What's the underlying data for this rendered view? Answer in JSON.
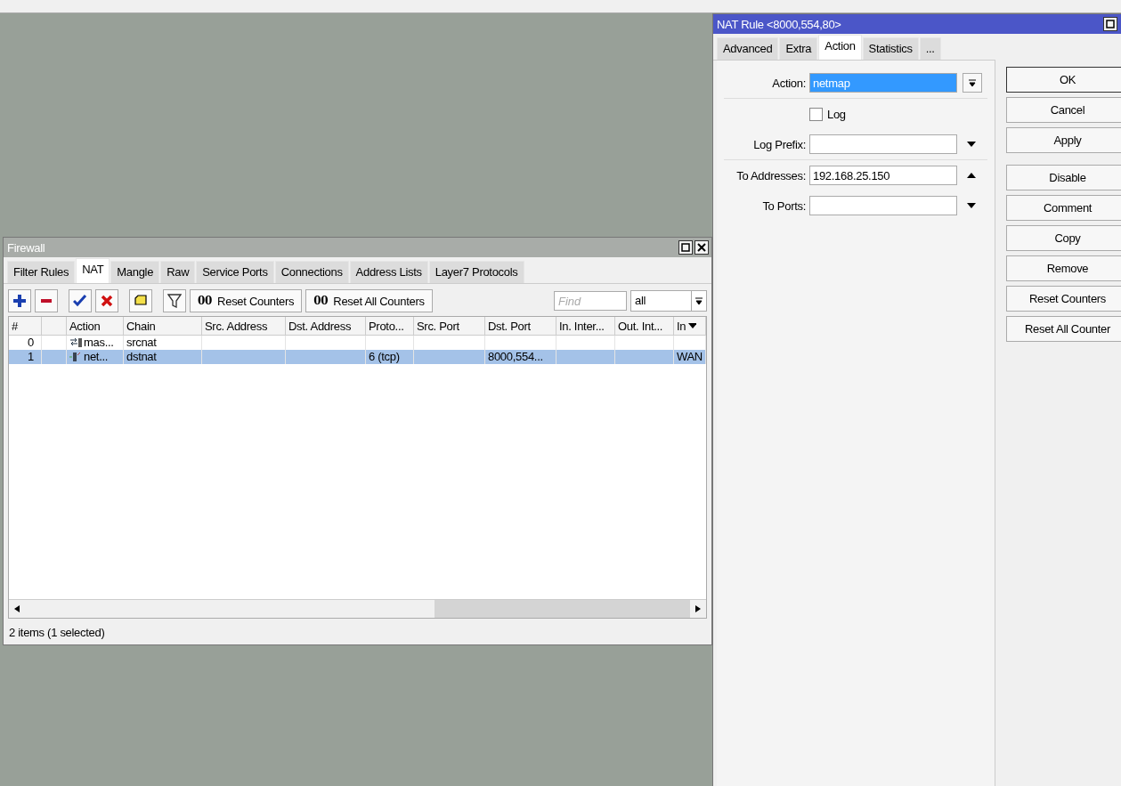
{
  "firewall": {
    "title": "Firewall",
    "tabs": [
      {
        "label": "Filter Rules",
        "selected": false
      },
      {
        "label": "NAT",
        "selected": true
      },
      {
        "label": "Mangle",
        "selected": false
      },
      {
        "label": "Raw",
        "selected": false
      },
      {
        "label": "Service Ports",
        "selected": false
      },
      {
        "label": "Connections",
        "selected": false
      },
      {
        "label": "Address Lists",
        "selected": false
      },
      {
        "label": "Layer7 Protocols",
        "selected": false
      }
    ],
    "toolbar": [
      {
        "kind": "add"
      },
      {
        "kind": "remove"
      },
      {
        "kind": "enable"
      },
      {
        "kind": "disable"
      },
      {
        "kind": "comment"
      },
      {
        "kind": "filter"
      },
      {
        "kind": "text",
        "icon": "00",
        "label": "Reset Counters"
      },
      {
        "kind": "text",
        "icon": "00",
        "label": "Reset All Counters"
      }
    ],
    "find": {
      "placeholder": "Find"
    },
    "filter_select": {
      "value": "all"
    },
    "columns": [
      "#",
      "",
      "Action",
      "Chain",
      "Src. Address",
      "Dst. Address",
      "Proto...",
      "Src. Port",
      "Dst. Port",
      "In. Inter...",
      "Out. Int...",
      "In"
    ],
    "rows": [
      {
        "selected": false,
        "kind": "masquerade",
        "cells": [
          "0",
          "",
          "mas...",
          "srcnat",
          "",
          "",
          "",
          "",
          "",
          "",
          "",
          ""
        ]
      },
      {
        "selected": true,
        "kind": "netmap",
        "cells": [
          "1",
          "",
          "net...",
          "dstnat",
          "",
          "",
          "6 (tcp)",
          "",
          "8000,554...",
          "",
          "",
          "WAN"
        ]
      }
    ],
    "status": "2 items (1 selected)"
  },
  "nat_rule": {
    "title": "NAT Rule <8000,554,80>",
    "tabs": [
      {
        "label": "Advanced",
        "selected": false
      },
      {
        "label": "Extra",
        "selected": false
      },
      {
        "label": "Action",
        "selected": true
      },
      {
        "label": "Statistics",
        "selected": false
      },
      {
        "label": "...",
        "selected": false
      }
    ],
    "field_groups": [
      [
        {
          "kind": "select",
          "label": "Action:",
          "value": "netmap",
          "highlighted": true
        }
      ],
      [
        {
          "kind": "checkbox",
          "label": "Log",
          "checked": false
        },
        {
          "kind": "dropdown",
          "label": "Log Prefix:"
        }
      ],
      [
        {
          "kind": "collapse",
          "label": "To Addresses:",
          "value": "192.168.25.150"
        },
        {
          "kind": "dropdown",
          "label": "To Ports:"
        }
      ]
    ],
    "button_groups": [
      [
        {
          "label": "OK",
          "default": true
        },
        {
          "label": "Cancel",
          "default": false
        },
        {
          "label": "Apply",
          "default": false
        }
      ],
      [
        {
          "label": "Disable",
          "default": false
        },
        {
          "label": "Comment",
          "default": false
        },
        {
          "label": "Copy",
          "default": false
        },
        {
          "label": "Remove",
          "default": false
        },
        {
          "label": "Reset Counters",
          "default": false
        },
        {
          "label": "Reset All Counter",
          "default": false
        }
      ]
    ]
  }
}
